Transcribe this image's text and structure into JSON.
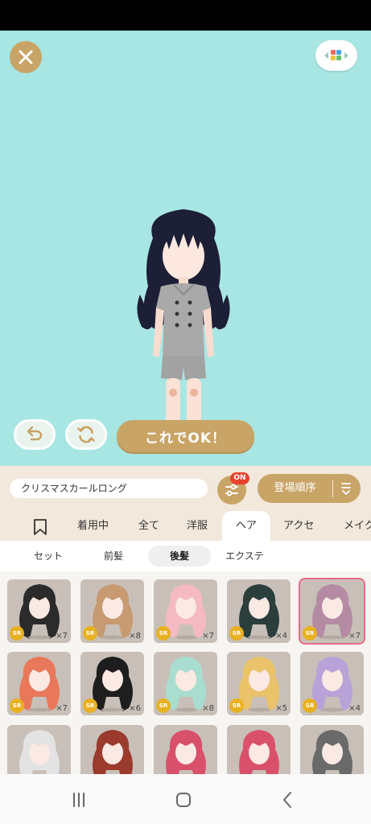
{
  "colors": {
    "stage_bg": "#a7e6e3",
    "gold": "#c9a467",
    "panel": "#f2e8db",
    "on_badge": "#e8412e",
    "sr_badge": "#e8b122",
    "selected_border": "#e86b86"
  },
  "top": {
    "close_icon": "close-icon",
    "palette_icon": "color-palette-icon"
  },
  "actions": {
    "ok_label": "これでOK！",
    "undo_icon": "undo-icon",
    "reset_icon": "refresh-icon"
  },
  "item_bar": {
    "item_name": "クリスマスカールロング",
    "filter_badge": "ON",
    "sort_label": "登場順序"
  },
  "tabs": [
    "着用中",
    "全て",
    "洋服",
    "ヘア",
    "アクセ",
    "メイク"
  ],
  "active_tab": "ヘア",
  "subtabs": [
    "セット",
    "前髪",
    "後髪",
    "エクステ"
  ],
  "active_subtab": "後髪",
  "items": [
    {
      "rarity": "SR",
      "count": "×7",
      "hair_color": "#2b2b2b"
    },
    {
      "rarity": "SR",
      "count": "×8",
      "hair_color": "#c79a72"
    },
    {
      "rarity": "SR",
      "count": "×7",
      "hair_color": "#f4b9c3"
    },
    {
      "rarity": "SR",
      "count": "×4",
      "hair_color": "#2b3e3c"
    },
    {
      "rarity": "SR",
      "count": "×7",
      "hair_color": "#b58ba3",
      "selected": true
    },
    {
      "rarity": "SR",
      "count": "×7",
      "hair_color": "#e9785a"
    },
    {
      "rarity": "SR",
      "count": "×6",
      "hair_color": "#1e1e1e"
    },
    {
      "rarity": "SR",
      "count": "×8",
      "hair_color": "#a9ddd0"
    },
    {
      "rarity": "SR",
      "count": "×5",
      "hair_color": "#e9c26a"
    },
    {
      "rarity": "SR",
      "count": "×4",
      "hair_color": "#b8a2d8"
    },
    {
      "rarity": "",
      "count": "",
      "hair_color": "#e3e3e3"
    },
    {
      "rarity": "",
      "count": "",
      "hair_color": "#9a3b2e"
    },
    {
      "rarity": "",
      "count": "",
      "hair_color": "#d9506a"
    },
    {
      "rarity": "",
      "count": "",
      "hair_color": "#d9506a"
    },
    {
      "rarity": "",
      "count": "",
      "hair_color": "#6a6a6a"
    }
  ],
  "nav": [
    "recent-apps-icon",
    "home-icon",
    "back-icon"
  ]
}
